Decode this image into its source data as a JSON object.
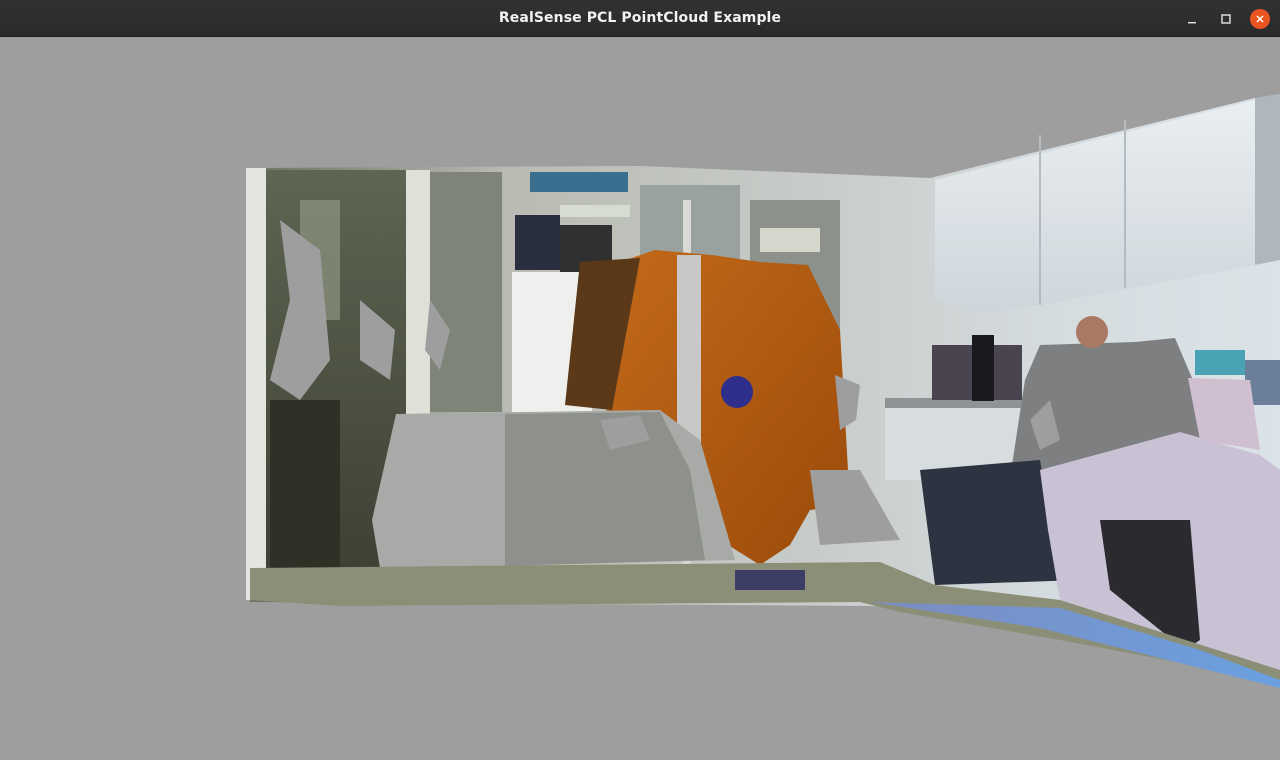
{
  "window": {
    "title": "RealSense PCL PointCloud Example"
  },
  "controls": {
    "minimize_icon": "minimize-icon",
    "maximize_icon": "maximize-icon",
    "close_icon": "close-icon"
  },
  "viewport": {
    "background_color": "#9e9e9e",
    "content": "3D point cloud render of a room"
  },
  "colors": {
    "titlebar": "#2c2c2c",
    "close_button": "#e95420"
  }
}
